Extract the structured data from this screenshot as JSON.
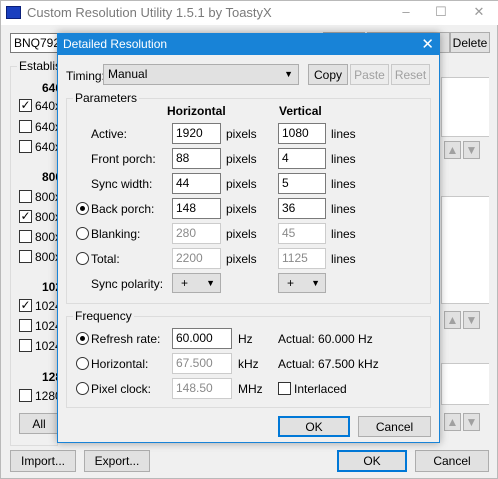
{
  "main": {
    "title": "Custom Resolution Utility 1.5.1 by ToastyX",
    "window_controls": {
      "minimize": "–",
      "maximize": "☐",
      "close": "✕"
    },
    "monitor_partial": "BNQ7925",
    "delete_label": "Delete",
    "established_label": "Establis",
    "sections": [
      {
        "header": "640",
        "items": [
          {
            "text": "640x",
            "checked": true
          },
          {
            "text": "640x",
            "checked": false
          },
          {
            "text": "640x",
            "checked": false
          }
        ]
      },
      {
        "header": "800",
        "items": [
          {
            "text": "800x",
            "checked": false
          },
          {
            "text": "800x",
            "checked": true
          },
          {
            "text": "800x",
            "checked": false
          },
          {
            "text": "800x",
            "checked": false
          }
        ]
      },
      {
        "header": "102",
        "items": [
          {
            "text": "1024",
            "checked": true
          },
          {
            "text": "1024",
            "checked": false
          },
          {
            "text": "1024",
            "checked": false
          }
        ]
      },
      {
        "header": "128",
        "items": [
          {
            "text": "1280",
            "checked": false
          }
        ]
      }
    ],
    "all_label": "All",
    "import_label": "Import...",
    "export_label": "Export...",
    "ok_label": "OK",
    "cancel_label": "Cancel"
  },
  "dialog": {
    "title": "Detailed Resolution",
    "close": "✕",
    "timing_label": "Timing:",
    "timing_value": "Manual",
    "copy_label": "Copy",
    "paste_label": "Paste",
    "reset_label": "Reset",
    "parameters": {
      "legend": "Parameters",
      "horizontal_header": "Horizontal",
      "vertical_header": "Vertical",
      "rows": [
        {
          "label": "Active:",
          "h": "1920",
          "h_unit": "pixels",
          "v": "1080",
          "v_unit": "lines"
        },
        {
          "label": "Front porch:",
          "h": "88",
          "h_unit": "pixels",
          "v": "4",
          "v_unit": "lines"
        },
        {
          "label": "Sync width:",
          "h": "44",
          "h_unit": "pixels",
          "v": "5",
          "v_unit": "lines"
        },
        {
          "label": "Back porch:",
          "h": "148",
          "h_unit": "pixels",
          "v": "36",
          "v_unit": "lines",
          "radio": true,
          "selected": true
        },
        {
          "label": "Blanking:",
          "h": "280",
          "h_unit": "pixels",
          "v": "45",
          "v_unit": "lines",
          "radio": true,
          "selected": false
        },
        {
          "label": "Total:",
          "h": "2200",
          "h_unit": "pixels",
          "v": "1125",
          "v_unit": "lines",
          "radio": true,
          "selected": false
        }
      ],
      "sync_polarity_label": "Sync polarity:",
      "h_polarity": "+",
      "v_polarity": "+"
    },
    "frequency": {
      "legend": "Frequency",
      "refresh_label": "Refresh rate:",
      "refresh_value": "60.000",
      "refresh_unit": "Hz",
      "refresh_actual": "Actual: 60.000 Hz",
      "horizontal_label": "Horizontal:",
      "horizontal_value": "67.500",
      "horizontal_unit": "kHz",
      "horizontal_actual": "Actual: 67.500 kHz",
      "pixel_clock_label": "Pixel clock:",
      "pixel_clock_value": "148.50",
      "pixel_clock_unit": "MHz",
      "interlaced_label": "Interlaced",
      "interlaced_checked": false
    },
    "ok_label": "OK",
    "cancel_label": "Cancel"
  }
}
